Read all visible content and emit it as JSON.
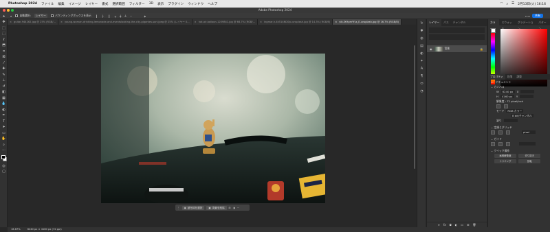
{
  "mac_menu": {
    "app": "Photoshop 2024",
    "items": [
      "ファイル",
      "編集",
      "イメージ",
      "レイヤー",
      "書式",
      "選択範囲",
      "フィルター",
      "3D",
      "表示",
      "プラグイン",
      "ウィンドウ",
      "ヘルプ"
    ],
    "clock": "2月13日(火) 16:16"
  },
  "window": {
    "title": "Adobe Photoshop 2024"
  },
  "options": {
    "autoselect_label": "自動選択:",
    "layer_select": "レイヤー",
    "transform_label": "バウンディングボックスを表示",
    "more": "···",
    "share": "共有"
  },
  "tabs": [
    {
      "label": "guitar-944262.jpg @ 25% (RGB/..."
    },
    {
      "label": "young-woman-drinking-lemonade-and-eventslooking-the-city-gigantes-sort.jpeg @ 25% (レイヤー 0..."
    },
    {
      "label": "hot-air-balloon-1209841.jpg @ 66.7% (RGB/..."
    },
    {
      "label": "ingmar-h-4k514ND0Jo-unsplash.jpg @ 14.3% (RGB/8)"
    },
    {
      "label": "nik-fXHpmYfLs_E-unsplash.jpg @ 16.7% (RGB/8)",
      "active": true
    }
  ],
  "contextual_bar": {
    "select_subject": "被写体を選択",
    "remove_bg": "背景を削除",
    "more": "···"
  },
  "status": {
    "zoom": "16.67%",
    "doc": "6240 px × 4160 px (72 ppi)"
  },
  "layers_panel": {
    "tabs": [
      "レイヤー",
      "パス",
      "チャンネル"
    ],
    "layer_name": "背景"
  },
  "color_panel": {
    "tabs": [
      "カラー",
      "スウォッチ",
      "グラデーション",
      "パターン"
    ],
    "fg": "#ffffff",
    "bg": "#000000"
  },
  "properties": {
    "tabs": [
      "プロパティ",
      "段落",
      "調整"
    ],
    "doc_label": "ドキュメント",
    "canvas_head": "カンバス",
    "w": "6240 px",
    "h": "4160 px",
    "x_label": "X",
    "y_label": "Y",
    "resolution": "解像度 : 72 pixel/inch",
    "mode_label": "モード",
    "mode_value": "RGB カラー",
    "depth_value": "8 bit/チャンネル",
    "fill_label": "塗り",
    "rulers_head": "定規とグリッド",
    "unit": "pixel",
    "guides_head": "ガイド",
    "quick_head": "クイック操作",
    "q1": "画像解像度",
    "q2": "切り抜き",
    "q3": "トリミング",
    "q4": "回転"
  }
}
